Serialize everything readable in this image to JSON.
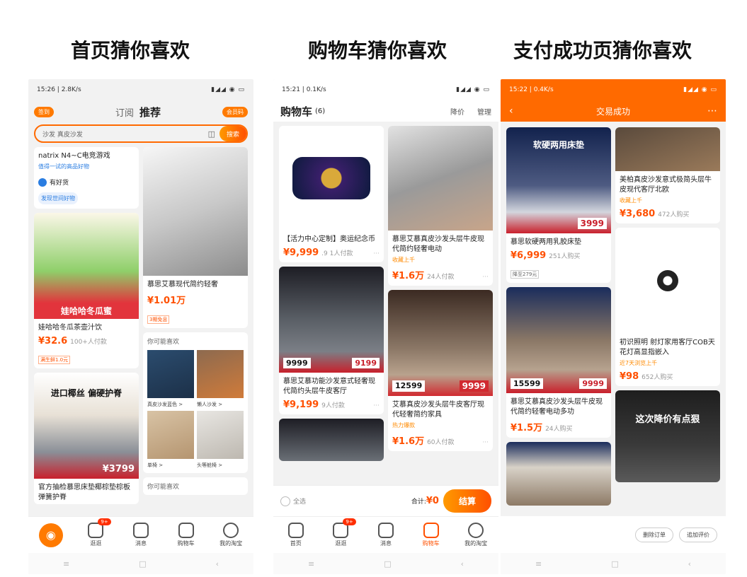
{
  "captions": {
    "home": "首页猜你喜欢",
    "cart": "购物车猜你喜欢",
    "paid": "支付成功页猜你喜欢"
  },
  "home": {
    "status_left": "15:26 | 2.8K/s",
    "sign_pill": "签到",
    "tab_follow": "订阅",
    "tab_recommend": "推荐",
    "member_pill": "会员码",
    "search_placeholder": "沙发 真皮沙发",
    "search_button": "搜索",
    "items": [
      {
        "title": "natrix N4~C电竞游戏",
        "sub": "值得一试的高品好物",
        "tag1": "有好货",
        "tag2": "发现世间好物"
      },
      {
        "title": "娃哈哈冬瓜茶壶汁饮",
        "price": "¥32.6",
        "meta": "100+人付款",
        "tag": "满生鲜1.0元",
        "banner": "娃哈哈冬瓜蜜"
      },
      {
        "title": "官方抽检慕思床垫椰棕垫棕板弹簧护脊",
        "banner": "进口椰丝 偏硬护脊",
        "promo": "¥3799"
      },
      {
        "title": "慕思艾慕现代简约轻奢",
        "price": "¥1.01万",
        "tag": "3期免息"
      },
      {
        "title": "你可能喜欢",
        "sub1": "真皮沙发蓝色 >",
        "sub2": "懒人沙发 >",
        "sub3": "单椅 >",
        "sub4": "头等舱椅 >"
      },
      {
        "title": "你可能喜欢"
      }
    ],
    "tabs": [
      {
        "label": ""
      },
      {
        "label": "逛逛",
        "badge": "9+"
      },
      {
        "label": "消息"
      },
      {
        "label": "购物车"
      },
      {
        "label": "我的淘宝"
      }
    ]
  },
  "cart": {
    "status_left": "15:21 | 0.1K/s",
    "title": "购物车",
    "count": "(6)",
    "action1": "降价",
    "action2": "管理",
    "items": [
      {
        "title": "【活力中心定制】奥运纪念币",
        "price": "¥9,999",
        "meta": ".9 1人付款"
      },
      {
        "title": "慕思艾慕真皮沙发头层牛皮现代简约轻奢电动",
        "tagline": "收藏上千",
        "price": "¥1.6万",
        "meta": "24人付款"
      },
      {
        "title": "慕思艾慕功能沙发意式轻奢现代简约头层牛皮客厅",
        "price": "¥9,199",
        "meta": "9人付款",
        "promo": "9199",
        "promo2": "9999"
      },
      {
        "title": "艾慕真皮沙发头层牛皮客厅现代轻奢简约家具",
        "tagline": "热力爆款",
        "price": "¥1.6万",
        "meta": "60人付款",
        "promo": "12599",
        "promo2": "9999"
      }
    ],
    "select_all": "全选",
    "total_label": "合计:",
    "total_value": "¥0",
    "settle": "结算",
    "tabs": [
      {
        "label": "首页"
      },
      {
        "label": "逛逛",
        "badge": "9+"
      },
      {
        "label": "消息"
      },
      {
        "label": "购物车"
      },
      {
        "label": "我的淘宝"
      }
    ]
  },
  "paid": {
    "status_left": "15:22 | 0.4K/s",
    "title": "交易成功",
    "items": [
      {
        "title": "慕思软硬两用乳胶床垫",
        "banner": "软硬两用床垫",
        "price": "¥6,999",
        "meta": "251人购买",
        "tag": "降至279元",
        "promo": "3999"
      },
      {
        "title": "慕思艾慕真皮沙发头层牛皮现代简约轻奢电动多功",
        "price": "¥1.5万",
        "meta": "24人购买",
        "promo": "15599",
        "promo2": "9999"
      },
      {
        "title": "美柏真皮沙发意式极简头层牛皮现代客厅北欧",
        "tagline": "收藏上千",
        "price": "¥3,680",
        "meta": "472人购买"
      },
      {
        "title": "初识照明 射灯家用客厅COB天花灯高显指嵌入",
        "tagline": "近7天浏览上千",
        "price": "¥98",
        "meta": "652人购买"
      },
      {
        "banner": "这次降价有点狠"
      }
    ],
    "btn_delete": "删除订单",
    "btn_review": "追加评价"
  }
}
